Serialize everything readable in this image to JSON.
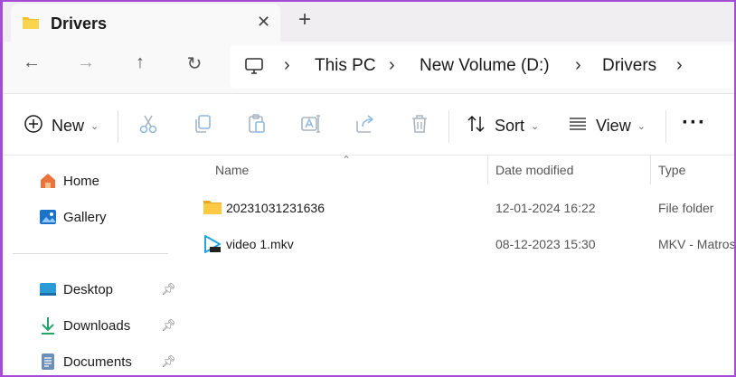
{
  "window": {
    "tab_title": "Drivers",
    "close_glyph": "✕",
    "new_tab_glyph": "+"
  },
  "nav": {
    "back_glyph": "←",
    "forward_glyph": "→",
    "up_glyph": "↑",
    "refresh_glyph": "↻",
    "breadcrumb": [
      "This PC",
      "New Volume (D:)",
      "Drivers"
    ]
  },
  "toolbar": {
    "new_label": "New",
    "sort_label": "Sort",
    "view_label": "View",
    "more_glyph": "···",
    "icons": [
      "cut-icon",
      "copy-icon",
      "paste-icon",
      "rename-icon",
      "share-icon",
      "delete-icon"
    ]
  },
  "sidebar": {
    "items": [
      {
        "label": "Home",
        "icon": "home-icon"
      },
      {
        "label": "Gallery",
        "icon": "gallery-icon"
      },
      {
        "label": "Desktop",
        "icon": "desktop-icon",
        "pinned": true
      },
      {
        "label": "Downloads",
        "icon": "downloads-icon",
        "pinned": true
      },
      {
        "label": "Documents",
        "icon": "documents-icon",
        "pinned": true
      }
    ]
  },
  "files": {
    "columns": [
      "Name",
      "Date modified",
      "Type"
    ],
    "rows": [
      {
        "name": "20231031231636",
        "date": "12-01-2024 16:22",
        "type": "File folder",
        "icon": "folder-icon"
      },
      {
        "name": "video 1.mkv",
        "date": "08-12-2023 15:30",
        "type": "MKV - Matroska",
        "icon": "video-file-icon"
      }
    ]
  },
  "colors": {
    "accent": "#a64bd6",
    "folder": "#f4c030",
    "link_blue": "#1a73c8"
  }
}
